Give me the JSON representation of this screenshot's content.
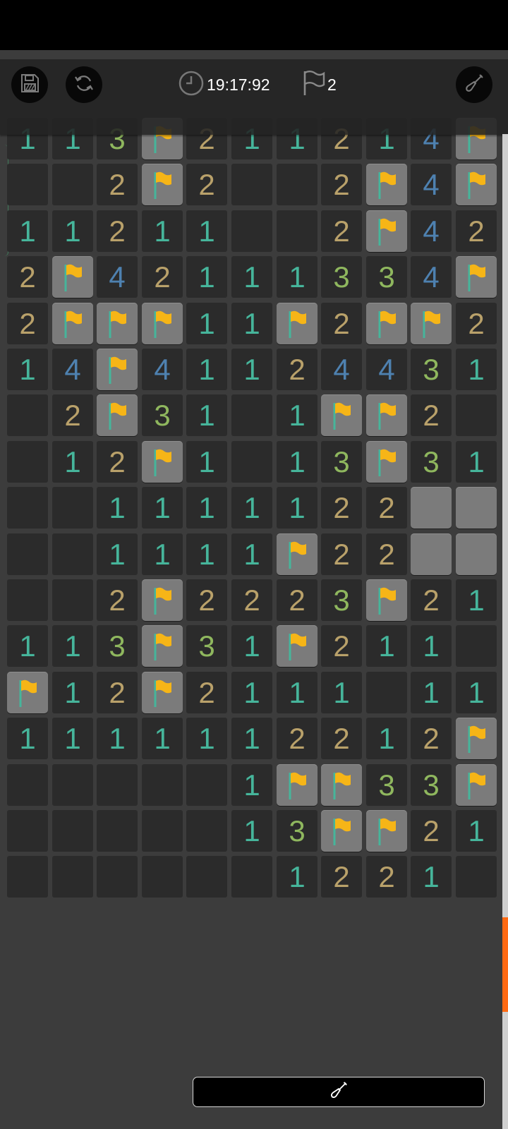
{
  "toolbar": {
    "save_icon": "save-icon",
    "restart_icon": "restart-icon",
    "timer": "19:17:92",
    "flags_count": "2",
    "mode_icon": "shovel-icon"
  },
  "colors": {
    "number_1": "#46b59b",
    "number_2": "#b9a16a",
    "number_3": "#8fb75e",
    "number_4": "#4e81b0",
    "flag": "#f6b517",
    "covered": "#7b7b7b",
    "revealed": "#2b2b2b",
    "scroll_thumb": "#ff6a13"
  },
  "board": {
    "columns": 11,
    "rows": [
      [
        "1",
        "1",
        "3",
        "F",
        "2",
        "1",
        "1",
        "2",
        "1",
        "4",
        "F"
      ],
      [
        "",
        "",
        "2",
        "F",
        "2",
        "",
        "",
        "2",
        "F",
        "4",
        "F"
      ],
      [
        "1",
        "1",
        "2",
        "1",
        "1",
        "",
        "",
        "2",
        "F",
        "4",
        "2"
      ],
      [
        "2",
        "F",
        "4",
        "2",
        "1",
        "1",
        "1",
        "3",
        "3",
        "4",
        "F"
      ],
      [
        "2",
        "F",
        "F",
        "F",
        "1",
        "1",
        "F",
        "2",
        "F",
        "F",
        "2"
      ],
      [
        "1",
        "4",
        "F",
        "4",
        "1",
        "1",
        "2",
        "4",
        "4",
        "3",
        "1"
      ],
      [
        "",
        "2",
        "F",
        "3",
        "1",
        "",
        "1",
        "F",
        "F",
        "2",
        ""
      ],
      [
        "",
        "1",
        "2",
        "F",
        "1",
        "",
        "1",
        "3",
        "F",
        "3",
        "1"
      ],
      [
        "",
        "",
        "1",
        "1",
        "1",
        "1",
        "1",
        "2",
        "2",
        "C",
        "C"
      ],
      [
        "",
        "",
        "1",
        "1",
        "1",
        "1",
        "F",
        "2",
        "2",
        "C",
        "C"
      ],
      [
        "",
        "",
        "2",
        "F",
        "2",
        "2",
        "2",
        "3",
        "F",
        "2",
        "1"
      ],
      [
        "1",
        "1",
        "3",
        "F",
        "3",
        "1",
        "F",
        "2",
        "1",
        "1",
        ""
      ],
      [
        "F",
        "1",
        "2",
        "F",
        "2",
        "1",
        "1",
        "1",
        "",
        "1",
        "1"
      ],
      [
        "1",
        "1",
        "1",
        "1",
        "1",
        "1",
        "2",
        "2",
        "1",
        "2",
        "F"
      ],
      [
        "",
        "",
        "",
        "",
        "",
        "1",
        "F",
        "F",
        "3",
        "3",
        "F"
      ],
      [
        "",
        "",
        "",
        "",
        "",
        "1",
        "3",
        "F",
        "F",
        "2",
        "1"
      ],
      [
        "",
        "",
        "",
        "",
        "",
        "",
        "1",
        "2",
        "2",
        "1",
        ""
      ]
    ]
  },
  "bottom_button": {
    "icon": "shovel-icon"
  }
}
